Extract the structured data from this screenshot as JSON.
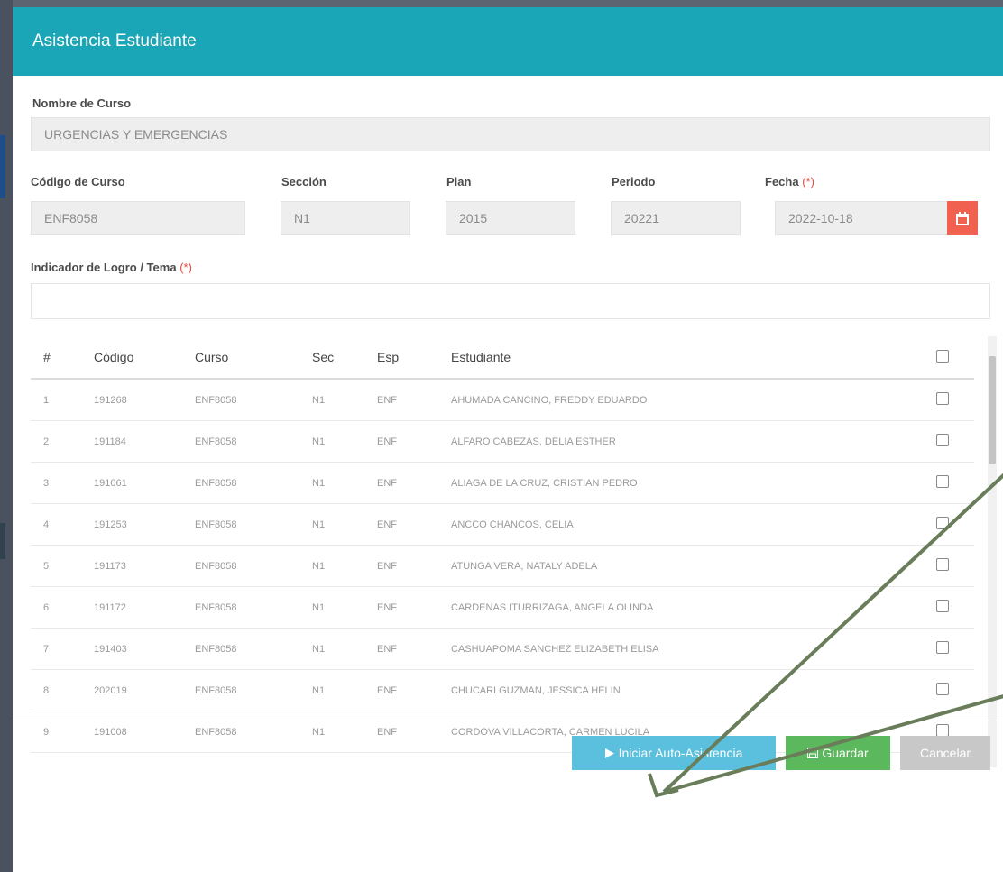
{
  "modal": {
    "title": "Asistencia Estudiante"
  },
  "form": {
    "course_name_label": "Nombre de Curso",
    "course_name_value": "URGENCIAS Y EMERGENCIAS",
    "code_label": "Código de Curso",
    "code_value": "ENF8058",
    "section_label": "Sección",
    "section_value": "N1",
    "plan_label": "Plan",
    "plan_value": "2015",
    "period_label": "Periodo",
    "period_value": "20221",
    "date_label": "Fecha",
    "required_mark": "(*)",
    "date_value": "2022-10-18",
    "indicator_label": "Indicador de Logro / Tema",
    "indicator_value": "",
    "calendar_icon": "calendar-icon"
  },
  "table": {
    "headers": [
      "#",
      "Código",
      "Curso",
      "Sec",
      "Esp",
      "Estudiante"
    ],
    "rows": [
      {
        "n": "1",
        "code": "191268",
        "course": "ENF8058",
        "sec": "N1",
        "esp": "ENF",
        "student": "AHUMADA CANCINO, FREDDY EDUARDO"
      },
      {
        "n": "2",
        "code": "191184",
        "course": "ENF8058",
        "sec": "N1",
        "esp": "ENF",
        "student": "ALFARO CABEZAS, DELIA ESTHER"
      },
      {
        "n": "3",
        "code": "191061",
        "course": "ENF8058",
        "sec": "N1",
        "esp": "ENF",
        "student": "ALIAGA DE LA CRUZ, CRISTIAN PEDRO"
      },
      {
        "n": "4",
        "code": "191253",
        "course": "ENF8058",
        "sec": "N1",
        "esp": "ENF",
        "student": "ANCCO CHANCOS, CELIA"
      },
      {
        "n": "5",
        "code": "191173",
        "course": "ENF8058",
        "sec": "N1",
        "esp": "ENF",
        "student": "ATUNGA VERA, NATALY ADELA"
      },
      {
        "n": "6",
        "code": "191172",
        "course": "ENF8058",
        "sec": "N1",
        "esp": "ENF",
        "student": "CARDENAS ITURRIZAGA, ANGELA OLINDA"
      },
      {
        "n": "7",
        "code": "191403",
        "course": "ENF8058",
        "sec": "N1",
        "esp": "ENF",
        "student": "CASHUAPOMA SANCHEZ ELIZABETH ELISA"
      },
      {
        "n": "8",
        "code": "202019",
        "course": "ENF8058",
        "sec": "N1",
        "esp": "ENF",
        "student": "CHUCARI GUZMAN, JESSICA HELIN"
      },
      {
        "n": "9",
        "code": "191008",
        "course": "ENF8058",
        "sec": "N1",
        "esp": "ENF",
        "student": "CORDOVA VILLACORTA, CARMEN LUCILA"
      }
    ]
  },
  "buttons": {
    "auto_attendance": "Iniciar Auto-Asistencia",
    "save": "Guardar",
    "cancel": "Cancelar",
    "auto_attendance_icon": "play-icon",
    "save_icon": "save-icon"
  },
  "colors": {
    "header": "#1aa6b7",
    "calendar_button": "#f0614f",
    "auto_attendance_button": "#5bc0de",
    "save_button": "#5cb85c",
    "cancel_button": "#c8c8c8",
    "annotation_arrow": "#6a7d5a"
  }
}
